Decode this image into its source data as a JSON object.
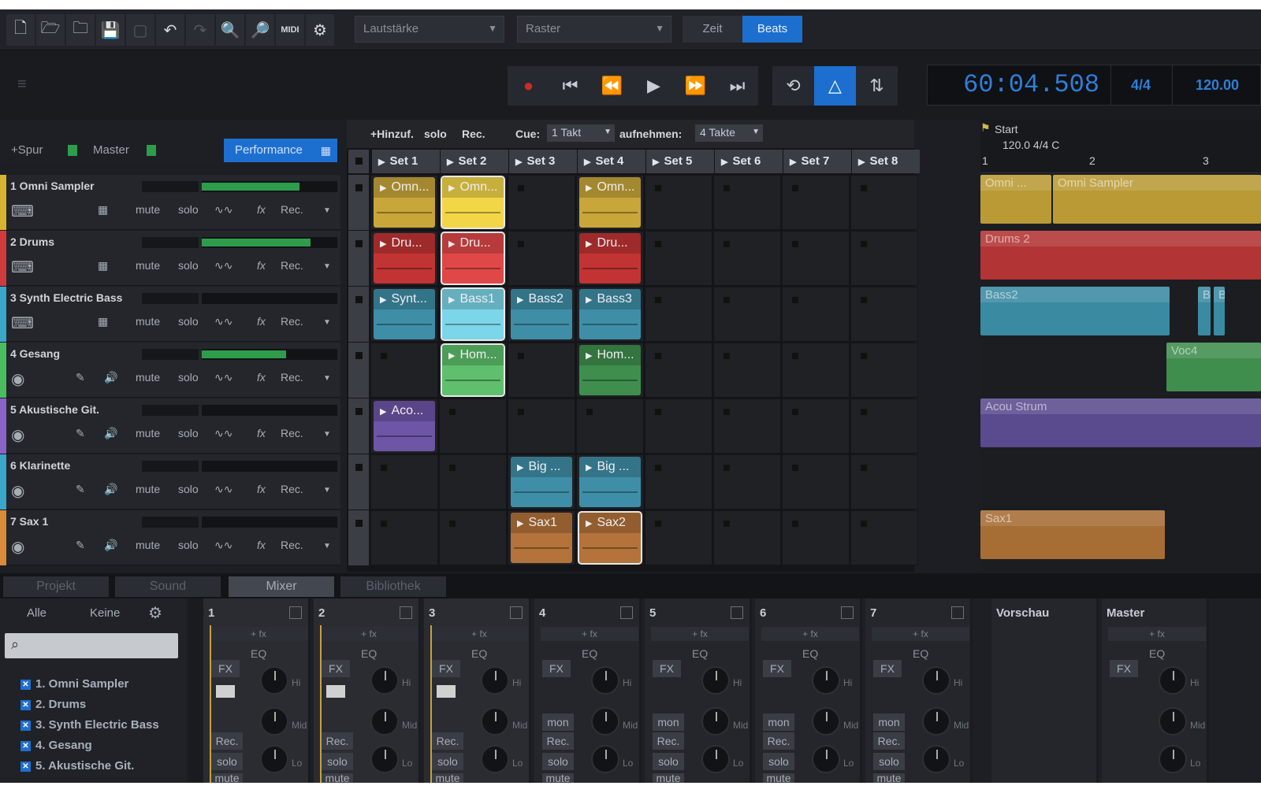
{
  "toolbar": {
    "icons": [
      "new-file-icon",
      "open-folder-icon",
      "folder-icon",
      "save-icon",
      "blank-icon",
      "undo-icon",
      "redo-icon",
      "zoom-in-icon",
      "zoom-out-icon",
      "midi-icon",
      "gear-icon"
    ],
    "midi_label": "MIDI",
    "volume_dropdown": "Lautstärke",
    "grid_dropdown": "Raster",
    "time_label": "Zeit",
    "beats_label": "Beats"
  },
  "transport": {
    "time": "60:04.508",
    "signature": "4/4",
    "tempo": "120.00"
  },
  "tracks_header": {
    "add_track": "+Spur",
    "master": "Master",
    "performance": "Performance"
  },
  "tracks": [
    {
      "name": "1 Omni Sampler",
      "color": "#d6b331",
      "meter": 0.72
    },
    {
      "name": "2 Drums",
      "color": "#d23b3b",
      "meter": 0.8
    },
    {
      "name": "3 Synth Electric Bass",
      "color": "#3aa7c9",
      "meter": 0.0
    },
    {
      "name": "4 Gesang",
      "color": "#4bbd60",
      "meter": 0.62
    },
    {
      "name": "5 Akustische Git.",
      "color": "#8b64c8",
      "meter": 0.0
    },
    {
      "name": "6 Klarinette",
      "color": "#3aa7c9",
      "meter": 0.0
    },
    {
      "name": "7 Sax 1",
      "color": "#d98a3a",
      "meter": 0.0
    }
  ],
  "track_controls": {
    "mute": "mute",
    "solo": "solo",
    "fx": "fx",
    "rec": "Rec."
  },
  "grid": {
    "add": "+Hinzuf.",
    "solo": "solo",
    "rec": "Rec.",
    "cue_label": "Cue:",
    "cue_value": "1 Takt",
    "record_label": "aufnehmen:",
    "record_value": "4 Takte",
    "sets": [
      "Set 1",
      "Set 2",
      "Set 3",
      "Set 4",
      "Set 5",
      "Set 6",
      "Set 7",
      "Set 8"
    ],
    "clips": [
      [
        {
          "name": "Omn...",
          "color": "#c9a63a"
        },
        {
          "name": "Omn...",
          "color": "#f3d648",
          "sel": true
        },
        null,
        {
          "name": "Omn...",
          "color": "#c9a63a"
        },
        null,
        null,
        null,
        null
      ],
      [
        {
          "name": "Dru...",
          "color": "#c23434"
        },
        {
          "name": "Dru...",
          "color": "#e04848",
          "sel": true
        },
        null,
        {
          "name": "Dru...",
          "color": "#c23434"
        },
        null,
        null,
        null,
        null
      ],
      [
        {
          "name": "Synt...",
          "color": "#3f8ea8"
        },
        {
          "name": "Bass1",
          "color": "#7cd6ea",
          "sel": true
        },
        {
          "name": "Bass2",
          "color": "#3f8ea8"
        },
        {
          "name": "Bass3",
          "color": "#3f8ea8"
        },
        null,
        null,
        null,
        null
      ],
      [
        null,
        {
          "name": "Hom...",
          "color": "#5fbf6c",
          "sel": true
        },
        null,
        {
          "name": "Hom...",
          "color": "#3f8e4e"
        },
        null,
        null,
        null,
        null
      ],
      [
        {
          "name": "Aco...",
          "color": "#6e55a6"
        },
        null,
        null,
        null,
        null,
        null,
        null,
        null
      ],
      [
        null,
        null,
        {
          "name": "Big ...",
          "color": "#3f8ea8"
        },
        {
          "name": "Big ...",
          "color": "#3f8ea8"
        },
        null,
        null,
        null,
        null
      ],
      [
        null,
        null,
        {
          "name": "Sax1",
          "color": "#b4733a"
        },
        {
          "name": "Sax2",
          "color": "#b4733a",
          "sel": true
        },
        null,
        null,
        null,
        null
      ]
    ]
  },
  "arrangement": {
    "start_label": "Start",
    "tempo_sig": "120.0 4/4 C",
    "bars": [
      "1",
      "2",
      "3"
    ],
    "clips": [
      {
        "label": "Omni ...",
        "color": "#b99a35",
        "row": 0,
        "from": 0,
        "to": 90
      },
      {
        "label": "Omni Sampler",
        "color": "#b99a35",
        "row": 0,
        "from": 92,
        "to": 356
      },
      {
        "label": "Drums 2",
        "color": "#b33434",
        "row": 1,
        "from": 0,
        "to": 356
      },
      {
        "label": "Bass2",
        "color": "#3a8aa2",
        "row": 2,
        "from": 0,
        "to": 240
      },
      {
        "label": "B",
        "color": "#3a8aa2",
        "row": 2,
        "from": 276,
        "to": 292
      },
      {
        "label": "B",
        "color": "#3a8aa2",
        "row": 2,
        "from": 296,
        "to": 310
      },
      {
        "label": "Voc4",
        "color": "#3f8e4e",
        "row": 3,
        "from": 236,
        "to": 356
      },
      {
        "label": "Acou Strum",
        "color": "#5a4a8e",
        "row": 4,
        "from": 0,
        "to": 356
      },
      {
        "label": "Sax1",
        "color": "#a66d35",
        "row": 6,
        "from": 0,
        "to": 234
      }
    ]
  },
  "bottom_tabs": [
    "Projekt",
    "Sound",
    "Mixer",
    "Bibliothek"
  ],
  "active_tab": "Mixer",
  "left_panel": {
    "all": "Alle",
    "none": "Keine",
    "items": [
      "1. Omni Sampler",
      "2.  Drums",
      "3. Synth Electric Bass",
      "4. Gesang",
      "5. Akustische Git."
    ]
  },
  "mixer": {
    "channels": [
      "1",
      "2",
      "3",
      "4",
      "5",
      "6",
      "7"
    ],
    "preview": "Vorschau",
    "master": "Master",
    "fx_slot": "+ fx",
    "eq": "EQ",
    "fx": "FX",
    "hi": "Hi",
    "mid": "Mid",
    "lo": "Lo",
    "rec": "Rec.",
    "solo": "solo",
    "mon": "mon",
    "mute": "mute"
  }
}
